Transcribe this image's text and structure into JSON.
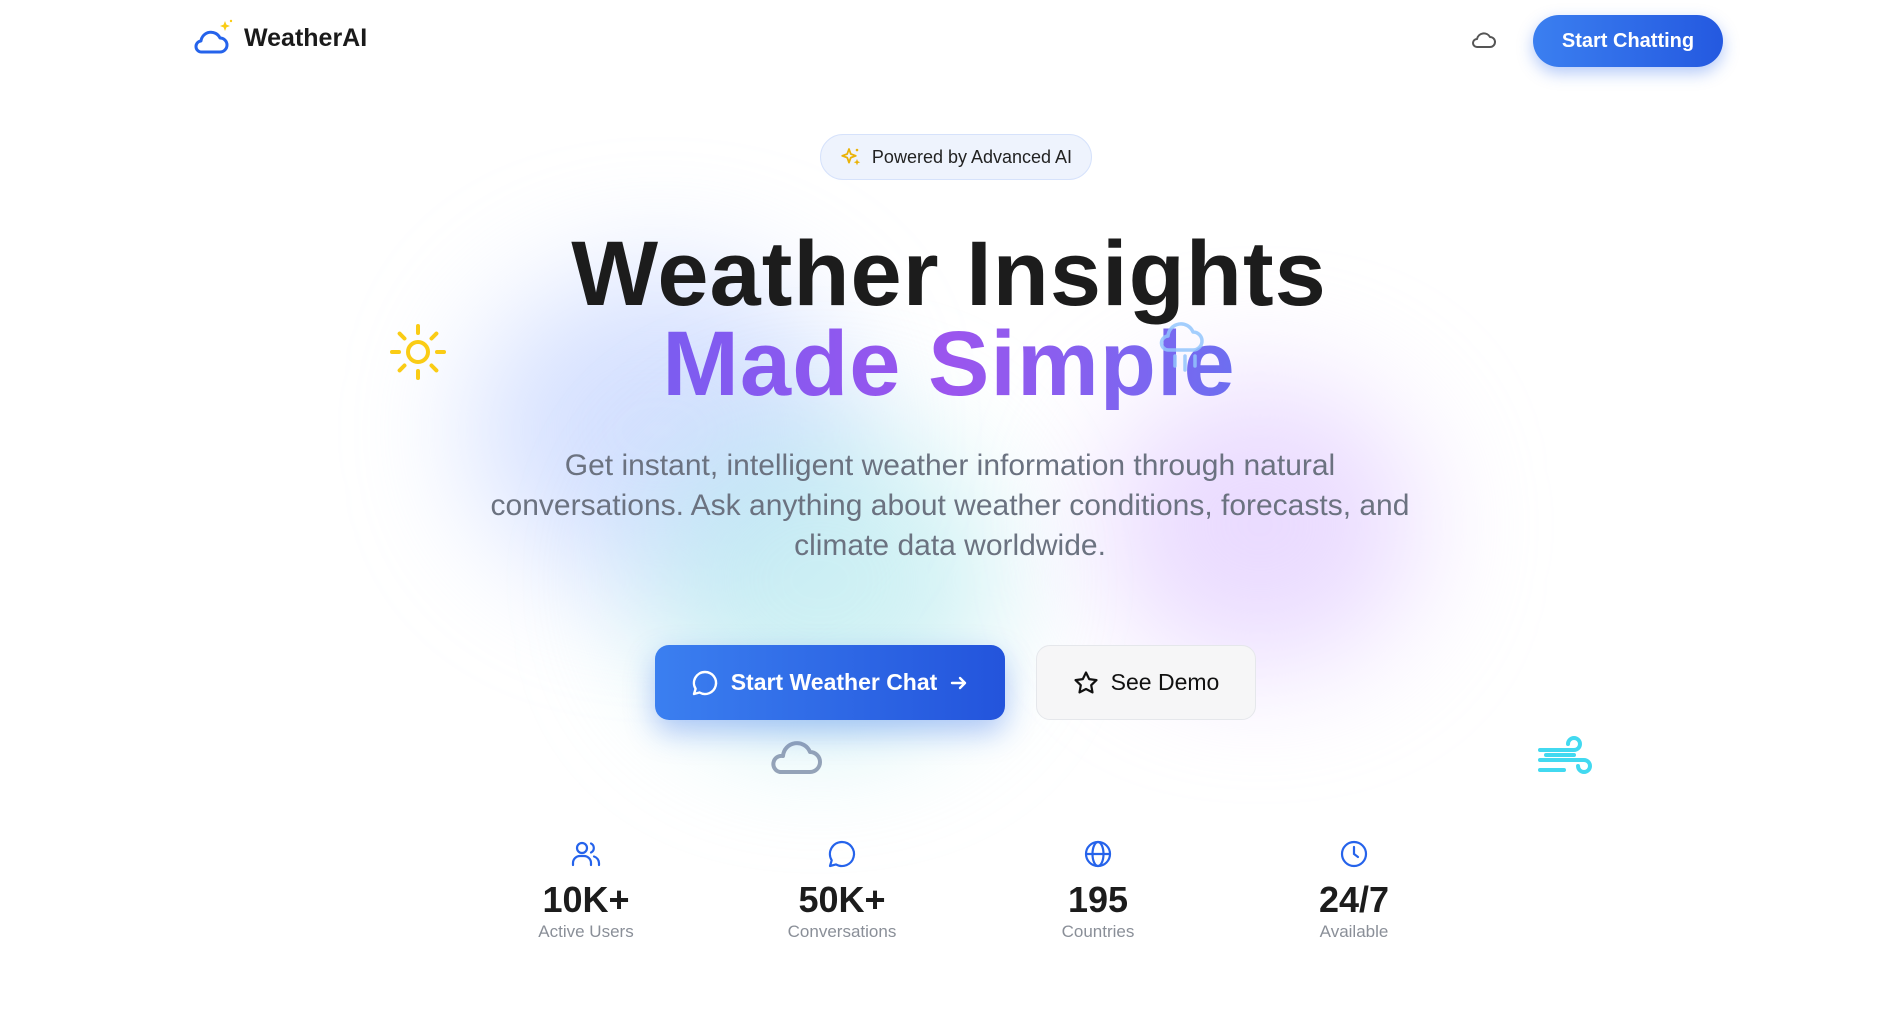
{
  "brand": {
    "name": "WeatherAI"
  },
  "nav": {
    "cta_label": "Start Chatting"
  },
  "badge": {
    "label": "Powered by Advanced AI"
  },
  "hero": {
    "title_line1": "Weather Insights",
    "title_line2": "Made Simple",
    "subtitle": "Get instant, intelligent weather information through natural conversations. Ask anything about weather conditions, forecasts, and climate data worldwide."
  },
  "actions": {
    "primary_label": "Start Weather Chat",
    "secondary_label": "See Demo"
  },
  "stats": [
    {
      "icon": "users-icon",
      "value": "10K+",
      "label": "Active Users"
    },
    {
      "icon": "chat-icon",
      "value": "50K+",
      "label": "Conversations"
    },
    {
      "icon": "globe-icon",
      "value": "195",
      "label": "Countries"
    },
    {
      "icon": "clock-icon",
      "value": "24/7",
      "label": "Available"
    }
  ],
  "colors": {
    "accent": "#2563eb",
    "gradient_start": "#3b82f6",
    "gradient_mid": "#9b55ee",
    "gradient_end": "#22b3e0",
    "sun": "#facc15",
    "wind": "#22d3ee"
  }
}
